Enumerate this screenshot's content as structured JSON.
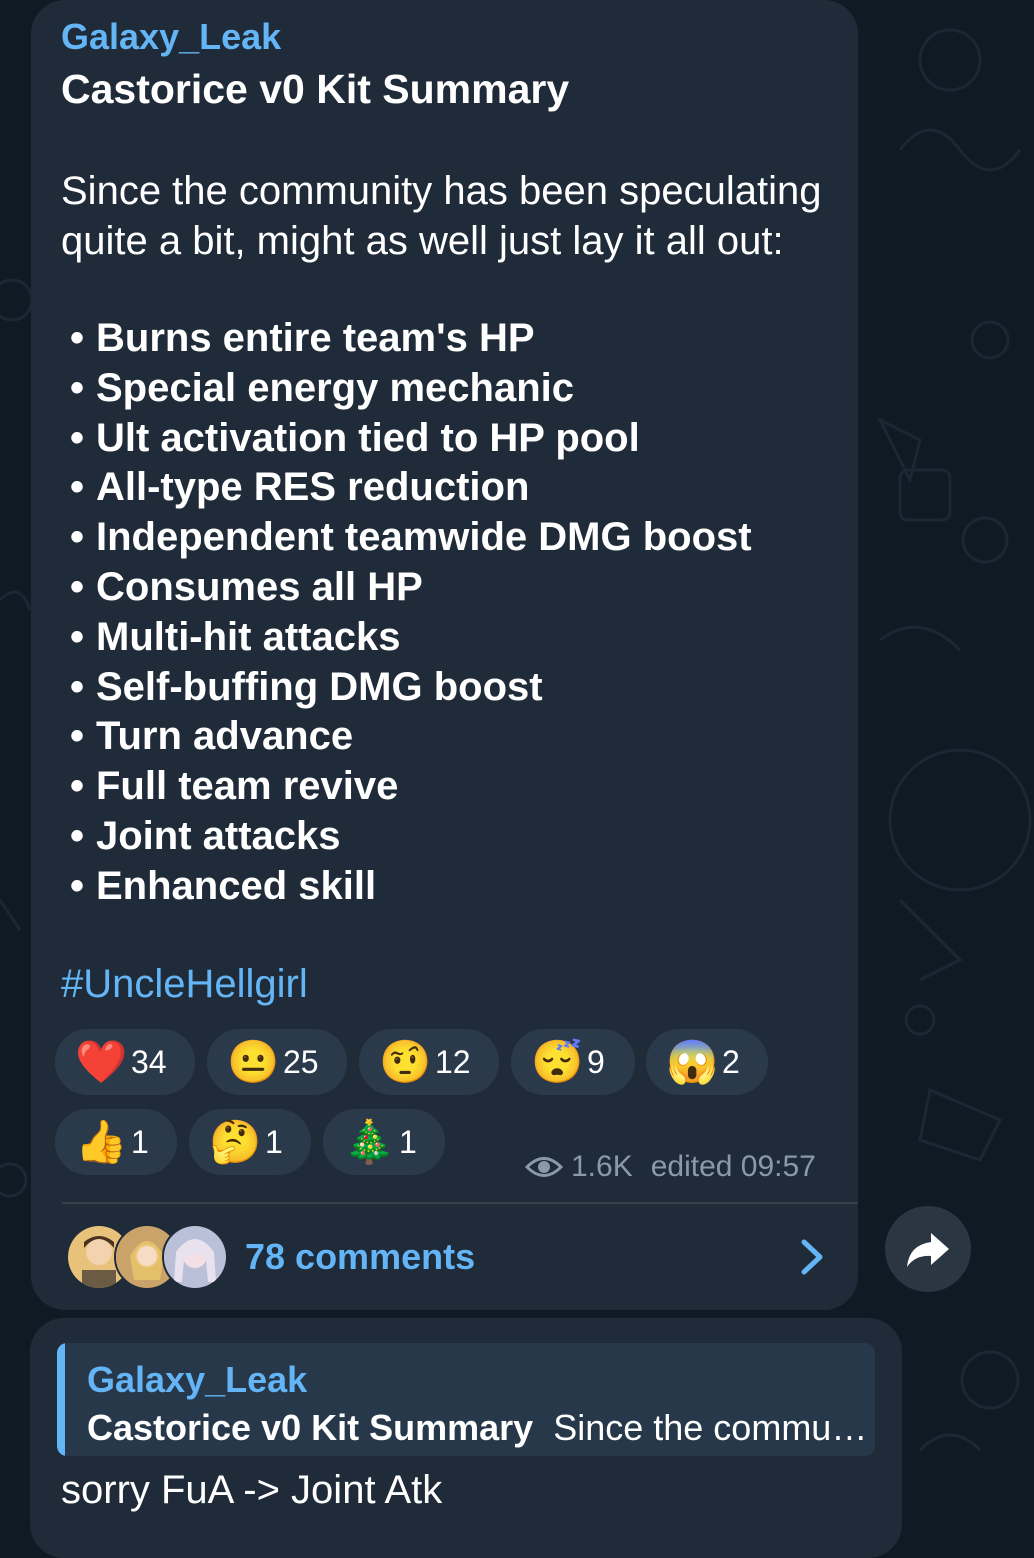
{
  "post": {
    "channel_name": "Galaxy_Leak",
    "title": "Castorice v0 Kit Summary",
    "intro": "Since the community has been speculating quite a bit, might as well just lay it all out:",
    "bullet_glyph": "•",
    "bullets": [
      "Burns entire team's HP",
      "Special energy mechanic",
      "Ult activation tied to HP pool",
      "All-type RES reduction",
      "Independent teamwide DMG boost",
      "Consumes all HP",
      "Multi-hit attacks",
      "Self-buffing DMG boost",
      "Turn advance",
      "Full team revive",
      "Joint attacks",
      "Enhanced skill"
    ],
    "hashtag": "#UncleHellgirl",
    "reactions": [
      {
        "emoji": "❤️",
        "icon": "red-heart-icon",
        "count": "34"
      },
      {
        "emoji": "😐",
        "icon": "neutral-face-icon",
        "count": "25"
      },
      {
        "emoji": "🤨",
        "icon": "raised-eyebrow-face-icon",
        "count": "12"
      },
      {
        "emoji": "😴",
        "icon": "sleeping-face-icon",
        "count": "9"
      },
      {
        "emoji": "😱",
        "icon": "screaming-face-icon",
        "count": "2"
      },
      {
        "emoji": "👍",
        "icon": "thumbs-up-icon",
        "count": "1"
      },
      {
        "emoji": "🤔",
        "icon": "thinking-face-icon",
        "count": "1"
      },
      {
        "emoji": "🎄",
        "icon": "christmas-tree-icon",
        "count": "1"
      }
    ],
    "views": "1.6K",
    "edited": "edited 09:57",
    "comments_label": "78 comments"
  },
  "reply": {
    "quote_name": "Galaxy_Leak",
    "quote_title": "Castorice v0 Kit Summary",
    "quote_snippet": "Since the commu…",
    "text": "sorry FuA -> Joint Atk"
  },
  "colors": {
    "background": "#0f1a24",
    "bubble": "#1f2b38",
    "accent": "#64b5f6",
    "reaction_pill": "#2b3a4a",
    "meta_text": "#8a9aaa"
  }
}
